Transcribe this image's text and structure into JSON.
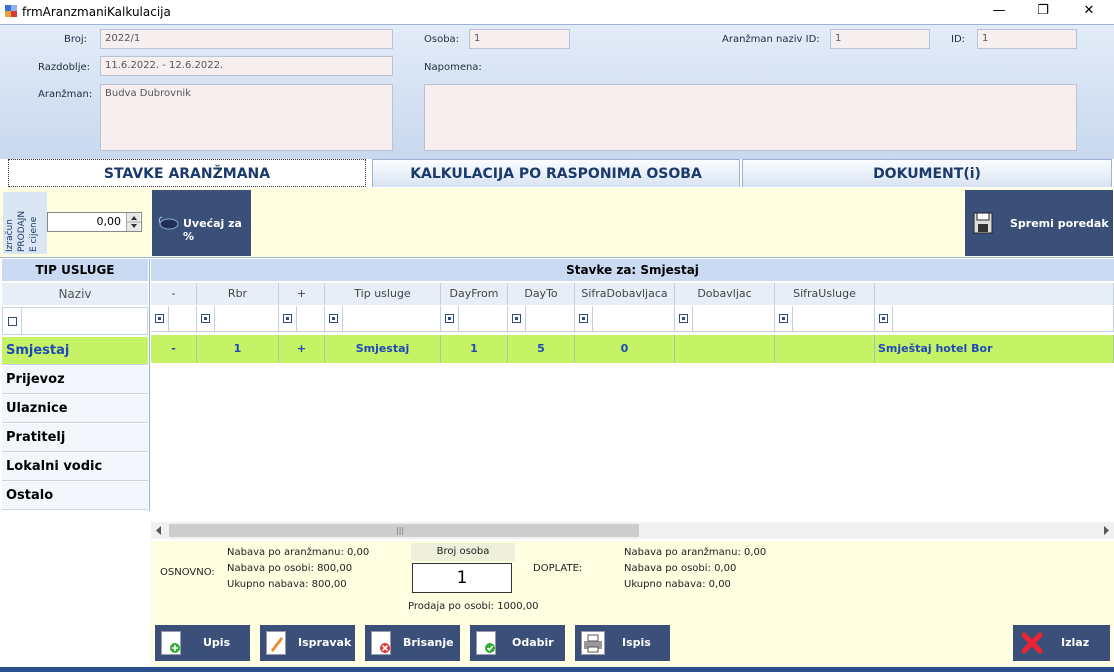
{
  "window": {
    "title": "frmAranzmaniKalkulacija",
    "minimize_glyph": "—",
    "restore_glyph": "❐",
    "close_glyph": "✕"
  },
  "header": {
    "broj_label": "Broj:",
    "broj_value": "2022/1",
    "osoba_label": "Osoba:",
    "osoba_value": "1",
    "aranzman_naziv_id_label": "Aranžman naziv ID:",
    "aranzman_naziv_id_value": "1",
    "id_label": "ID:",
    "id_value": "1",
    "razdoblje_label": "Razdoblje:",
    "razdoblje_value": "11.6.2022. - 12.6.2022.",
    "napomena_label": "Napomena:",
    "napomena_value": "",
    "aranzman_label": "Aranžman:",
    "aranzman_value": "Budva Dubrovnik"
  },
  "tabs": [
    {
      "label": "STAVKE ARANŽMANA"
    },
    {
      "label": "KALKULACIJA PO RASPONIMA OSOBA"
    },
    {
      "label": "DOKUMENT(i)"
    }
  ],
  "toolbar": {
    "vertical_label_1": "Izračun",
    "vertical_label_2": "PRODAJN",
    "vertical_label_3": "E cijene",
    "percent_value": "0,00",
    "increase_label": "Uvećaj za %",
    "save_order_label": "Spremi poredak"
  },
  "left_panel": {
    "header": "TIP USLUGE",
    "column": "Naziv",
    "items": [
      {
        "label": "Smjestaj"
      },
      {
        "label": "Prijevoz"
      },
      {
        "label": "Ulaznice"
      },
      {
        "label": "Pratitelj"
      },
      {
        "label": "Lokalni vodic"
      },
      {
        "label": "Ostalo"
      }
    ]
  },
  "grid": {
    "title": "Stavke za: Smjestaj",
    "columns": [
      "-",
      "Rbr",
      "+",
      "Tip usluge",
      "DayFrom",
      "DayTo",
      "SifraDobavljaca",
      "Dobavljac",
      "SifraUsluge",
      ""
    ],
    "rows": [
      [
        "-",
        "1",
        "+",
        "Smjestaj",
        "1",
        "5",
        "0",
        "",
        "",
        "Smještaj hotel Bor"
      ]
    ],
    "scroll_grip": "|||"
  },
  "summary": {
    "osnovno_label": "OSNOVNO:",
    "osnovno_lines": [
      "Nabava po aranžmanu: 0,00",
      "Nabava po osobi: 800,00",
      "Ukupno nabava: 800,00"
    ],
    "broj_osoba_label": "Broj osoba",
    "broj_osoba_value": "1",
    "prodaja_po_osobi": "Prodaja po osobi: 1000,00",
    "doplate_label": "DOPLATE:",
    "doplate_lines": [
      "Nabava po aranžmanu: 0,00",
      "Nabava po osobi: 0,00",
      "Ukupno nabava: 0,00"
    ]
  },
  "actions": {
    "upis": "Upis",
    "ispravak": "Ispravak",
    "brisanje": "Brisanje",
    "odabir": "Odabir",
    "ispis": "Ispis",
    "izlaz": "Izlaz"
  }
}
